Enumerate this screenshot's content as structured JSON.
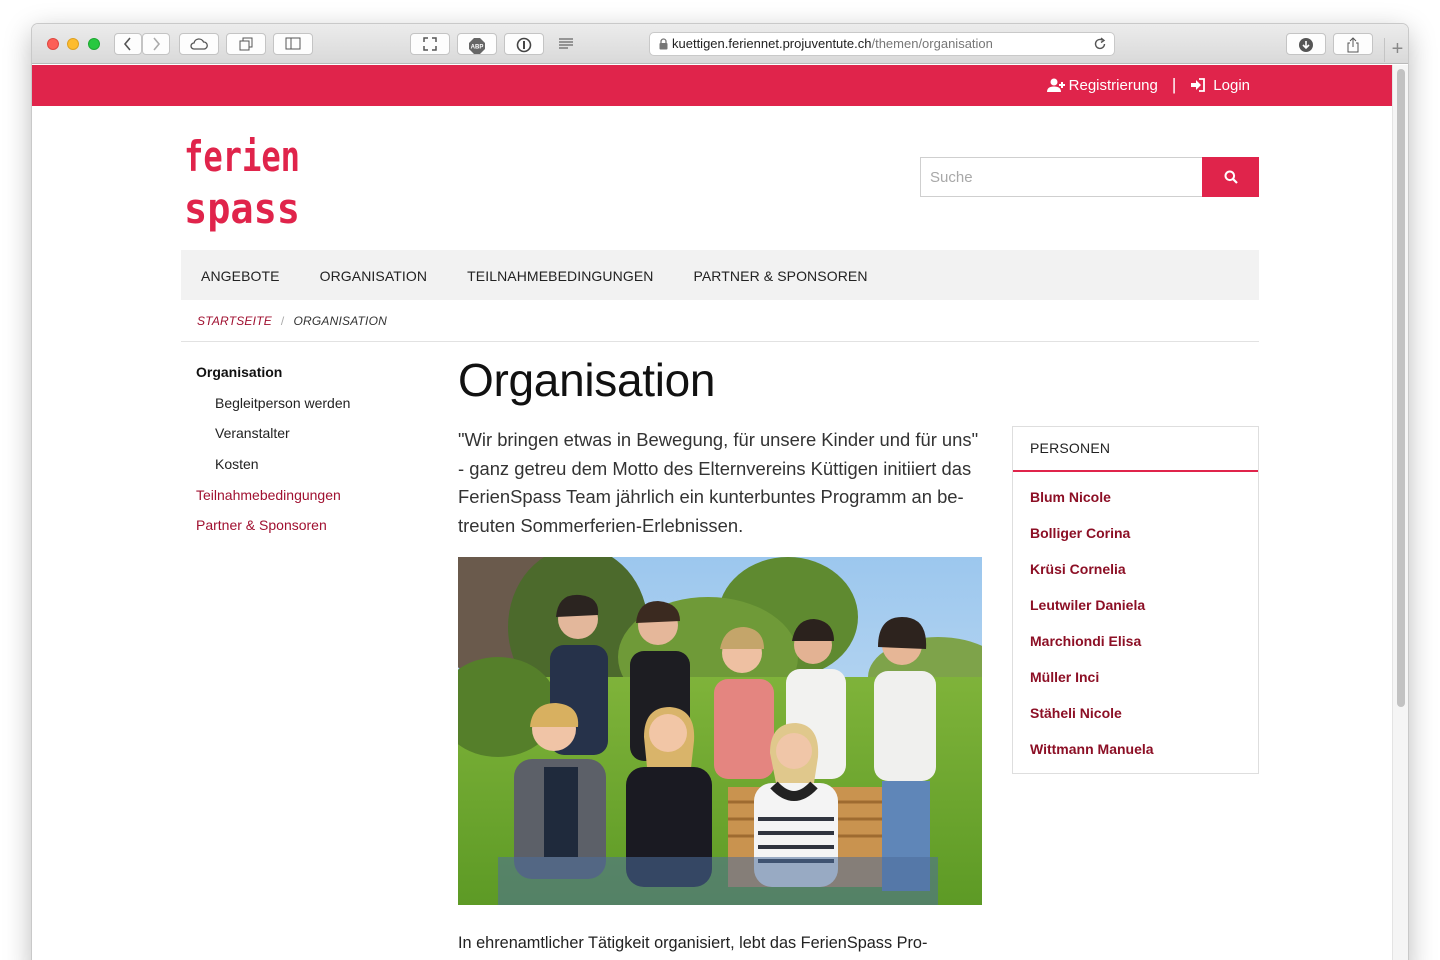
{
  "browser": {
    "url_host": "kuettigen.feriennet.projuventute.ch",
    "url_path": "/themen/organisation"
  },
  "topbar": {
    "register_label": "Registrierung",
    "separator": "|",
    "login_label": "Login"
  },
  "logo": {
    "line1": "ferien",
    "line2": "spass"
  },
  "search": {
    "placeholder": "Suche"
  },
  "nav": {
    "items": [
      {
        "label": "ANGEBOTE"
      },
      {
        "label": "ORGANISATION"
      },
      {
        "label": "TEILNAHMEBEDINGUNGEN"
      },
      {
        "label": "PARTNER & SPONSOREN"
      }
    ]
  },
  "breadcrumb": {
    "home": "STARTSEITE",
    "separator": "/",
    "current": "ORGANISATION"
  },
  "sidebar": {
    "items": [
      {
        "label": "Organisation"
      },
      {
        "label": "Begleitperson werden"
      },
      {
        "label": "Veranstalter"
      },
      {
        "label": "Kosten"
      },
      {
        "label": "Teilnahmebedingungen"
      },
      {
        "label": "Partner & Sponsoren"
      }
    ]
  },
  "main": {
    "title": "Organisation",
    "intro": "\"Wir bringen etwas in Bewegung, für unsere Kinder und für uns\" - ganz getreu dem Motto des Elternvereins Küttigen initiiert das FerienSpass Team jährlich ein kunterbuntes Programm an be-treuten Sommerferien-Erlebnissen.",
    "body": "In ehrenamtlicher Tätigkeit organisiert, lebt das FerienSpass Pro-"
  },
  "persons": {
    "heading": "PERSONEN",
    "names": [
      "Blum Nicole",
      "Bolliger Corina",
      "Krüsi Cornelia",
      "Leutwiler Daniela",
      "Marchiondi Elisa",
      "Müller Inci",
      "Stäheli Nicole",
      "Wittmann Manuela"
    ]
  },
  "colors": {
    "brand": "#e0244b",
    "link": "#a01030"
  }
}
